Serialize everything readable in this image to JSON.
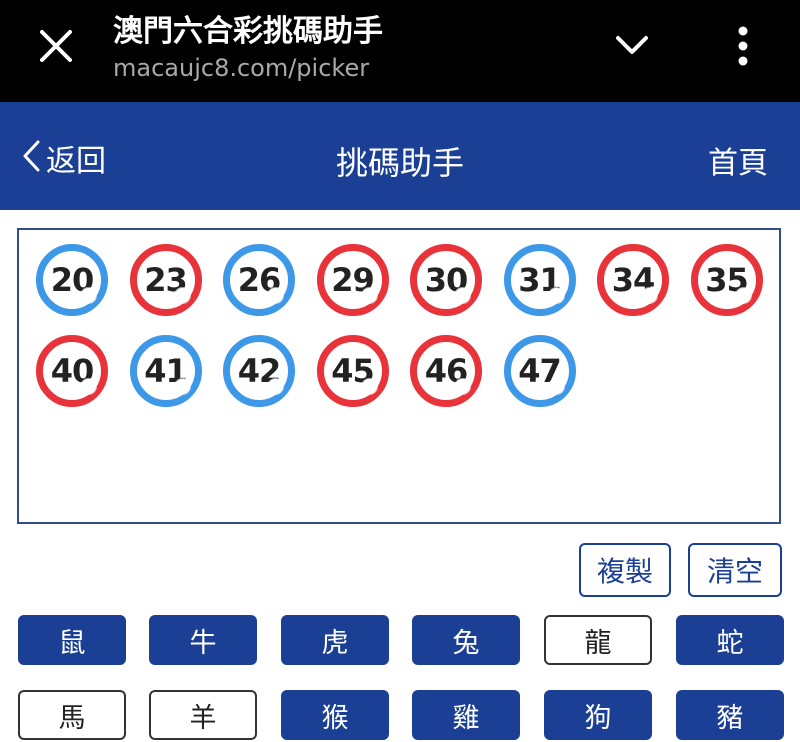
{
  "browser": {
    "title": "澳門六合彩挑碼助手",
    "url": "macaujc8.com/picker",
    "close_icon": "close-icon",
    "dropdown_icon": "chevron-down-icon",
    "menu_icon": "more-vert-icon"
  },
  "header": {
    "back_label": "返回",
    "title": "挑碼助手",
    "home_label": "首頁",
    "color": "#1b3f94"
  },
  "balls": [
    {
      "number": "20",
      "color": "blue"
    },
    {
      "number": "23",
      "color": "red"
    },
    {
      "number": "26",
      "color": "blue"
    },
    {
      "number": "29",
      "color": "red"
    },
    {
      "number": "30",
      "color": "red"
    },
    {
      "number": "31",
      "color": "blue"
    },
    {
      "number": "34",
      "color": "red"
    },
    {
      "number": "35",
      "color": "red"
    },
    {
      "number": "40",
      "color": "red"
    },
    {
      "number": "41",
      "color": "blue"
    },
    {
      "number": "42",
      "color": "blue"
    },
    {
      "number": "45",
      "color": "red"
    },
    {
      "number": "46",
      "color": "red"
    },
    {
      "number": "47",
      "color": "blue"
    }
  ],
  "actions": {
    "copy_label": "複製",
    "clear_label": "清空"
  },
  "zodiac": [
    {
      "label": "鼠",
      "selected": true
    },
    {
      "label": "牛",
      "selected": true
    },
    {
      "label": "虎",
      "selected": true
    },
    {
      "label": "兔",
      "selected": true
    },
    {
      "label": "龍",
      "selected": false
    },
    {
      "label": "蛇",
      "selected": true
    },
    {
      "label": "馬",
      "selected": false
    },
    {
      "label": "羊",
      "selected": false
    },
    {
      "label": "猴",
      "selected": true
    },
    {
      "label": "雞",
      "selected": true
    },
    {
      "label": "狗",
      "selected": true
    },
    {
      "label": "豬",
      "selected": true
    }
  ],
  "colors": {
    "red_ball": "#e8333a",
    "blue_ball": "#3e98e8",
    "accent": "#1b3f94"
  }
}
